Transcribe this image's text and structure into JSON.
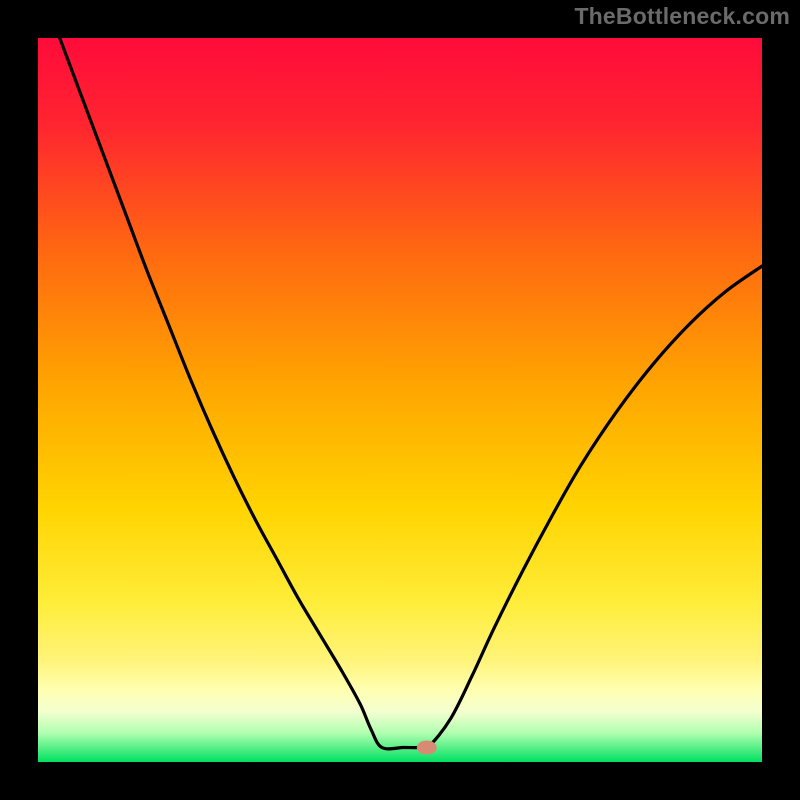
{
  "watermark": "TheBottleneck.com",
  "chart_data": {
    "type": "line",
    "title": "",
    "xlabel": "",
    "ylabel": "",
    "xlim": [
      0,
      100
    ],
    "ylim": [
      0,
      100
    ],
    "series": [
      {
        "name": "curve",
        "x": [
          3.0,
          6.0,
          9.0,
          12.0,
          15.0,
          18.0,
          21.0,
          24.0,
          27.0,
          30.0,
          33.0,
          36.0,
          39.0,
          42.0,
          44.5,
          46.0,
          47.5,
          50.5,
          52.5,
          54.0,
          57.0,
          60.0,
          63.0,
          67.0,
          71.0,
          75.0,
          80.0,
          85.0,
          90.0,
          95.0,
          100.0
        ],
        "y": [
          100.0,
          92.0,
          84.0,
          76.0,
          68.0,
          60.5,
          53.0,
          46.0,
          39.5,
          33.5,
          28.0,
          22.5,
          17.5,
          12.5,
          8.0,
          4.5,
          2.0,
          2.0,
          2.0,
          2.2,
          6.0,
          12.0,
          18.5,
          26.5,
          34.0,
          41.0,
          48.5,
          55.0,
          60.5,
          65.0,
          68.5
        ]
      }
    ],
    "marker": {
      "x": 53.7,
      "y": 2.0,
      "color": "#d88a75"
    },
    "background_gradient": {
      "top": "#ff0040",
      "mid1": "#ff7a00",
      "mid2": "#ffe600",
      "band": "#ffffa0",
      "bottom": "#00e060"
    },
    "plot_frame_color": "#000000",
    "plot_frame_thickness_px": 38
  }
}
